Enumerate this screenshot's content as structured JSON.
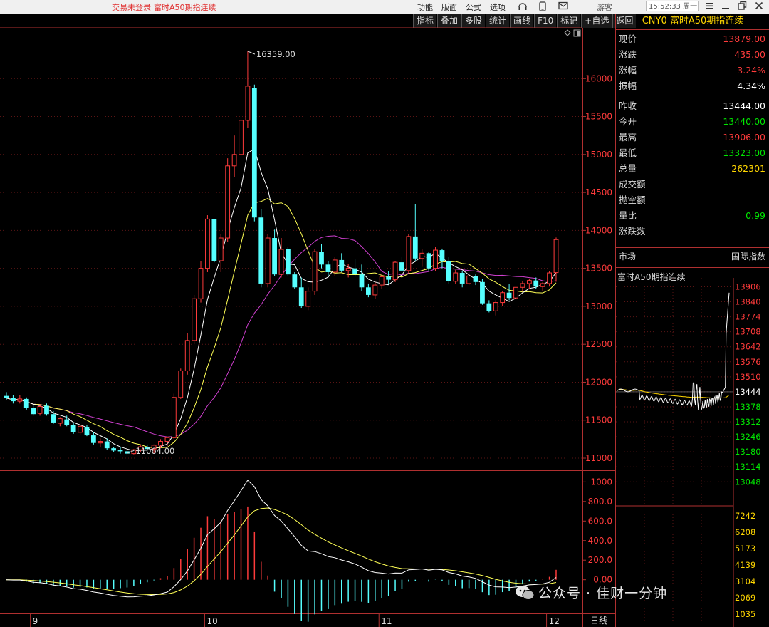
{
  "top_bar": {
    "login_status": "交易未登录",
    "instrument": "富时A50期指连续",
    "menu": [
      "功能",
      "版面",
      "公式",
      "选项"
    ],
    "time": "15:52:33",
    "weekday": "周一",
    "user": "游客"
  },
  "toolbar": [
    "指标",
    "叠加",
    "多股",
    "统计",
    "画线",
    "F10",
    "标记",
    "+自选",
    "返回"
  ],
  "chart_data": [
    {
      "type": "candlestick",
      "x_axis_labels": [
        "9",
        "10",
        "11",
        "12"
      ],
      "y_ticks": [
        11000,
        11500,
        12000,
        12500,
        13000,
        13500,
        14000,
        14500,
        15000,
        15500,
        16000
      ],
      "ylim": [
        10850,
        16650
      ],
      "annotations": [
        {
          "label": "16359.00",
          "value": 16359
        },
        {
          "label": "11064.00",
          "value": 11064
        }
      ],
      "ma_colors": {
        "ma5": "#ffffff",
        "ma10": "#ffff55",
        "ma20": "#d040d0"
      },
      "up_color": "#ff3b3b",
      "down_color": "#55ffff",
      "candles": [
        [
          11820,
          11870,
          11760,
          11790
        ],
        [
          11790,
          11830,
          11720,
          11750
        ],
        [
          11750,
          11830,
          11720,
          11780
        ],
        [
          11780,
          11800,
          11640,
          11660
        ],
        [
          11660,
          11700,
          11560,
          11580
        ],
        [
          11590,
          11710,
          11560,
          11680
        ],
        [
          11690,
          11720,
          11560,
          11580
        ],
        [
          11580,
          11620,
          11450,
          11470
        ],
        [
          11460,
          11540,
          11420,
          11520
        ],
        [
          11510,
          11560,
          11420,
          11440
        ],
        [
          11440,
          11470,
          11320,
          11340
        ],
        [
          11340,
          11430,
          11300,
          11420
        ],
        [
          11410,
          11440,
          11290,
          11300
        ],
        [
          11300,
          11340,
          11180,
          11200
        ],
        [
          11200,
          11260,
          11140,
          11220
        ],
        [
          11220,
          11260,
          11110,
          11130
        ],
        [
          11130,
          11150,
          11080,
          11100
        ],
        [
          11110,
          11150,
          11060,
          11090
        ],
        [
          11090,
          11140,
          11040,
          11060
        ],
        [
          11060,
          11120,
          11050,
          11110
        ],
        [
          11110,
          11180,
          11080,
          11150
        ],
        [
          11150,
          11180,
          11100,
          11120
        ],
        [
          11120,
          11180,
          11064,
          11170
        ],
        [
          11170,
          11250,
          11130,
          11220
        ],
        [
          11220,
          11280,
          11160,
          11270
        ],
        [
          11270,
          11850,
          11250,
          11800
        ],
        [
          11800,
          12180,
          11780,
          12150
        ],
        [
          12150,
          12650,
          12100,
          12550
        ],
        [
          12550,
          13150,
          12500,
          13100
        ],
        [
          13100,
          13600,
          13050,
          13500
        ],
        [
          13500,
          14200,
          13450,
          14150
        ],
        [
          14150,
          14050,
          13580,
          13600
        ],
        [
          13600,
          13950,
          13450,
          13900
        ],
        [
          13900,
          14950,
          13850,
          14850
        ],
        [
          14850,
          15250,
          14700,
          15000
        ],
        [
          15000,
          15550,
          14850,
          15450
        ],
        [
          15450,
          16359,
          15350,
          15900
        ],
        [
          15880,
          15920,
          14120,
          14170
        ],
        [
          14170,
          14280,
          13250,
          13300
        ],
        [
          13300,
          13950,
          13250,
          13900
        ],
        [
          13900,
          14010,
          13400,
          13420
        ],
        [
          13420,
          13900,
          13380,
          13750
        ],
        [
          13750,
          13780,
          13400,
          13420
        ],
        [
          13420,
          13450,
          13230,
          13250
        ],
        [
          13250,
          13380,
          12980,
          13000
        ],
        [
          13000,
          13250,
          12950,
          13200
        ],
        [
          13200,
          13750,
          13150,
          13720
        ],
        [
          13720,
          13820,
          13500,
          13550
        ],
        [
          13550,
          13600,
          13400,
          13450
        ],
        [
          13450,
          13650,
          13400,
          13610
        ],
        [
          13610,
          13700,
          13450,
          13470
        ],
        [
          13470,
          13560,
          13380,
          13500
        ],
        [
          13500,
          13620,
          13390,
          13420
        ],
        [
          13420,
          13550,
          13200,
          13250
        ],
        [
          13250,
          13300,
          13120,
          13150
        ],
        [
          13150,
          13320,
          13100,
          13280
        ],
        [
          13280,
          13420,
          13230,
          13390
        ],
        [
          13390,
          13460,
          13300,
          13350
        ],
        [
          13350,
          13600,
          13320,
          13580
        ],
        [
          13580,
          13650,
          13450,
          13470
        ],
        [
          13470,
          13950,
          13440,
          13920
        ],
        [
          13920,
          14350,
          13600,
          13630
        ],
        [
          13630,
          13750,
          13520,
          13700
        ],
        [
          13700,
          13720,
          13470,
          13500
        ],
        [
          13500,
          13780,
          13460,
          13740
        ],
        [
          13740,
          13760,
          13500,
          13600
        ],
        [
          13600,
          13650,
          13300,
          13330
        ],
        [
          13330,
          13480,
          13290,
          13440
        ],
        [
          13440,
          13460,
          13250,
          13300
        ],
        [
          13300,
          13420,
          13280,
          13400
        ],
        [
          13400,
          13420,
          13280,
          13320
        ],
        [
          13320,
          13360,
          13020,
          13040
        ],
        [
          13040,
          13080,
          12920,
          12940
        ],
        [
          12940,
          13080,
          12880,
          13050
        ],
        [
          13050,
          13200,
          13000,
          13180
        ],
        [
          13180,
          13290,
          13080,
          13110
        ],
        [
          13110,
          13280,
          13090,
          13250
        ],
        [
          13250,
          13330,
          13200,
          13300
        ],
        [
          13300,
          13360,
          13230,
          13340
        ],
        [
          13340,
          13380,
          13230,
          13260
        ],
        [
          13260,
          13320,
          13200,
          13300
        ],
        [
          13300,
          13460,
          13260,
          13440
        ],
        [
          13444,
          13906,
          13323,
          13879
        ]
      ]
    },
    {
      "type": "macd",
      "y_ticks": [
        0,
        200,
        400,
        600,
        800,
        1000
      ],
      "y_tick_labels": [
        "0.00",
        "200.0",
        "400.0",
        "600.0",
        "800.0",
        "1000"
      ],
      "ylim": [
        -330,
        1090
      ],
      "dif_color": "#ffffff",
      "dea_color": "#ffff55"
    },
    {
      "type": "line",
      "title": "富时A50期指连续",
      "base_value": 13444,
      "price_ticks": [
        13906,
        13840,
        13774,
        13708,
        13642,
        13576,
        13510,
        13444,
        13378,
        13312,
        13246,
        13180,
        13114,
        13048
      ],
      "volume_ticks": [
        7242,
        6208,
        5173,
        4139,
        3104,
        2069,
        1035
      ],
      "ylim": [
        13005,
        13920
      ]
    }
  ],
  "quote_panel": {
    "code": "CNY0",
    "name": "富时A50期指连续",
    "rows": [
      {
        "label": "现价",
        "value": "13879.00",
        "color": "red"
      },
      {
        "label": "涨跌",
        "value": "435.00",
        "color": "red"
      },
      {
        "label": "涨幅",
        "value": "3.24%",
        "color": "red"
      },
      {
        "label": "振幅",
        "value": "4.34%",
        "color": "white"
      },
      {
        "label": "昨收",
        "value": "13444.00",
        "color": "white"
      },
      {
        "label": "今开",
        "value": "13440.00",
        "color": "green"
      },
      {
        "label": "最高",
        "value": "13906.00",
        "color": "red"
      },
      {
        "label": "最低",
        "value": "13323.00",
        "color": "green"
      },
      {
        "label": "总量",
        "value": "262301",
        "color": "yellow"
      },
      {
        "label": "成交额",
        "value": "",
        "color": "white"
      },
      {
        "label": "抛空额",
        "value": "",
        "color": "white"
      },
      {
        "label": "量比",
        "value": "0.99",
        "color": "green"
      },
      {
        "label": "涨跌数",
        "value": "",
        "color": "white"
      }
    ],
    "market_label": "市场",
    "market_value": "国际指数"
  },
  "period_label": "日线",
  "watermark": "公众号 · 佳财一分钟"
}
